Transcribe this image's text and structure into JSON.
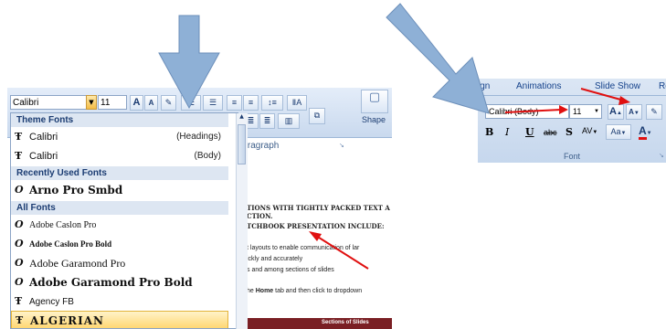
{
  "left_ribbon": {
    "font_name": "Calibri",
    "font_size": "11",
    "grow_font_label": "A",
    "shrink_font_label": "A",
    "paragraph_group_label": "Paragraph",
    "shapes_label": "Shape"
  },
  "dropdown": {
    "sections": [
      {
        "header": "Theme Fonts"
      },
      {
        "header": "Recently Used Fonts"
      },
      {
        "header": "All Fonts"
      }
    ],
    "theme_fonts": [
      {
        "name": "Calibri",
        "note": "(Headings)",
        "icon": "truetype-icon"
      },
      {
        "name": "Calibri",
        "note": "(Body)",
        "icon": "truetype-icon"
      }
    ],
    "recent_fonts": [
      {
        "name": "Arno Pro Smbd",
        "icon": "opentype-icon"
      }
    ],
    "all_fonts": [
      {
        "name": "Adobe Caslon Pro",
        "icon": "opentype-icon"
      },
      {
        "name": "Adobe Caslon Pro Bold",
        "icon": "opentype-icon"
      },
      {
        "name": "Adobe Garamond Pro",
        "icon": "opentype-icon"
      },
      {
        "name": "Adobe Garamond Pro Bold",
        "icon": "opentype-icon"
      },
      {
        "name": "Agency FB",
        "icon": "truetype-icon"
      },
      {
        "name": "ALGERIAN",
        "icon": "truetype-icon",
        "selected": true
      }
    ]
  },
  "document": {
    "line1": "TIONS WITH TIGHTLY PACKED TEXT A",
    "line2": "CTION.",
    "line3": "TCHBOOK PRESENTATION INCLUDE:",
    "line4": "t layouts to enable communication of lar",
    "line5": "ickly and accurately",
    "line6": "s and among sections of slides",
    "line7_pre": "he ",
    "line7_bold": "Home",
    "line7_post": " tab and then click to dropdown",
    "footer_label": "Sections of Slides"
  },
  "right_ribbon": {
    "tabs": [
      "ign",
      "Animations",
      "Slide Show",
      "Re"
    ],
    "font_name": "Calibri (Body)",
    "font_size": "11",
    "bold": "B",
    "italic": "I",
    "underline": "U",
    "strike": "abc",
    "shadow": "S",
    "spacing": "AV",
    "change_case": "Aa",
    "font_color": "A",
    "group_label": "Font"
  },
  "colors": {
    "arrow_blue": "#8eb0d6",
    "arrow_red": "#e01010",
    "doc_maroon": "#7a1f24",
    "selection_gold": "#ffd773"
  }
}
